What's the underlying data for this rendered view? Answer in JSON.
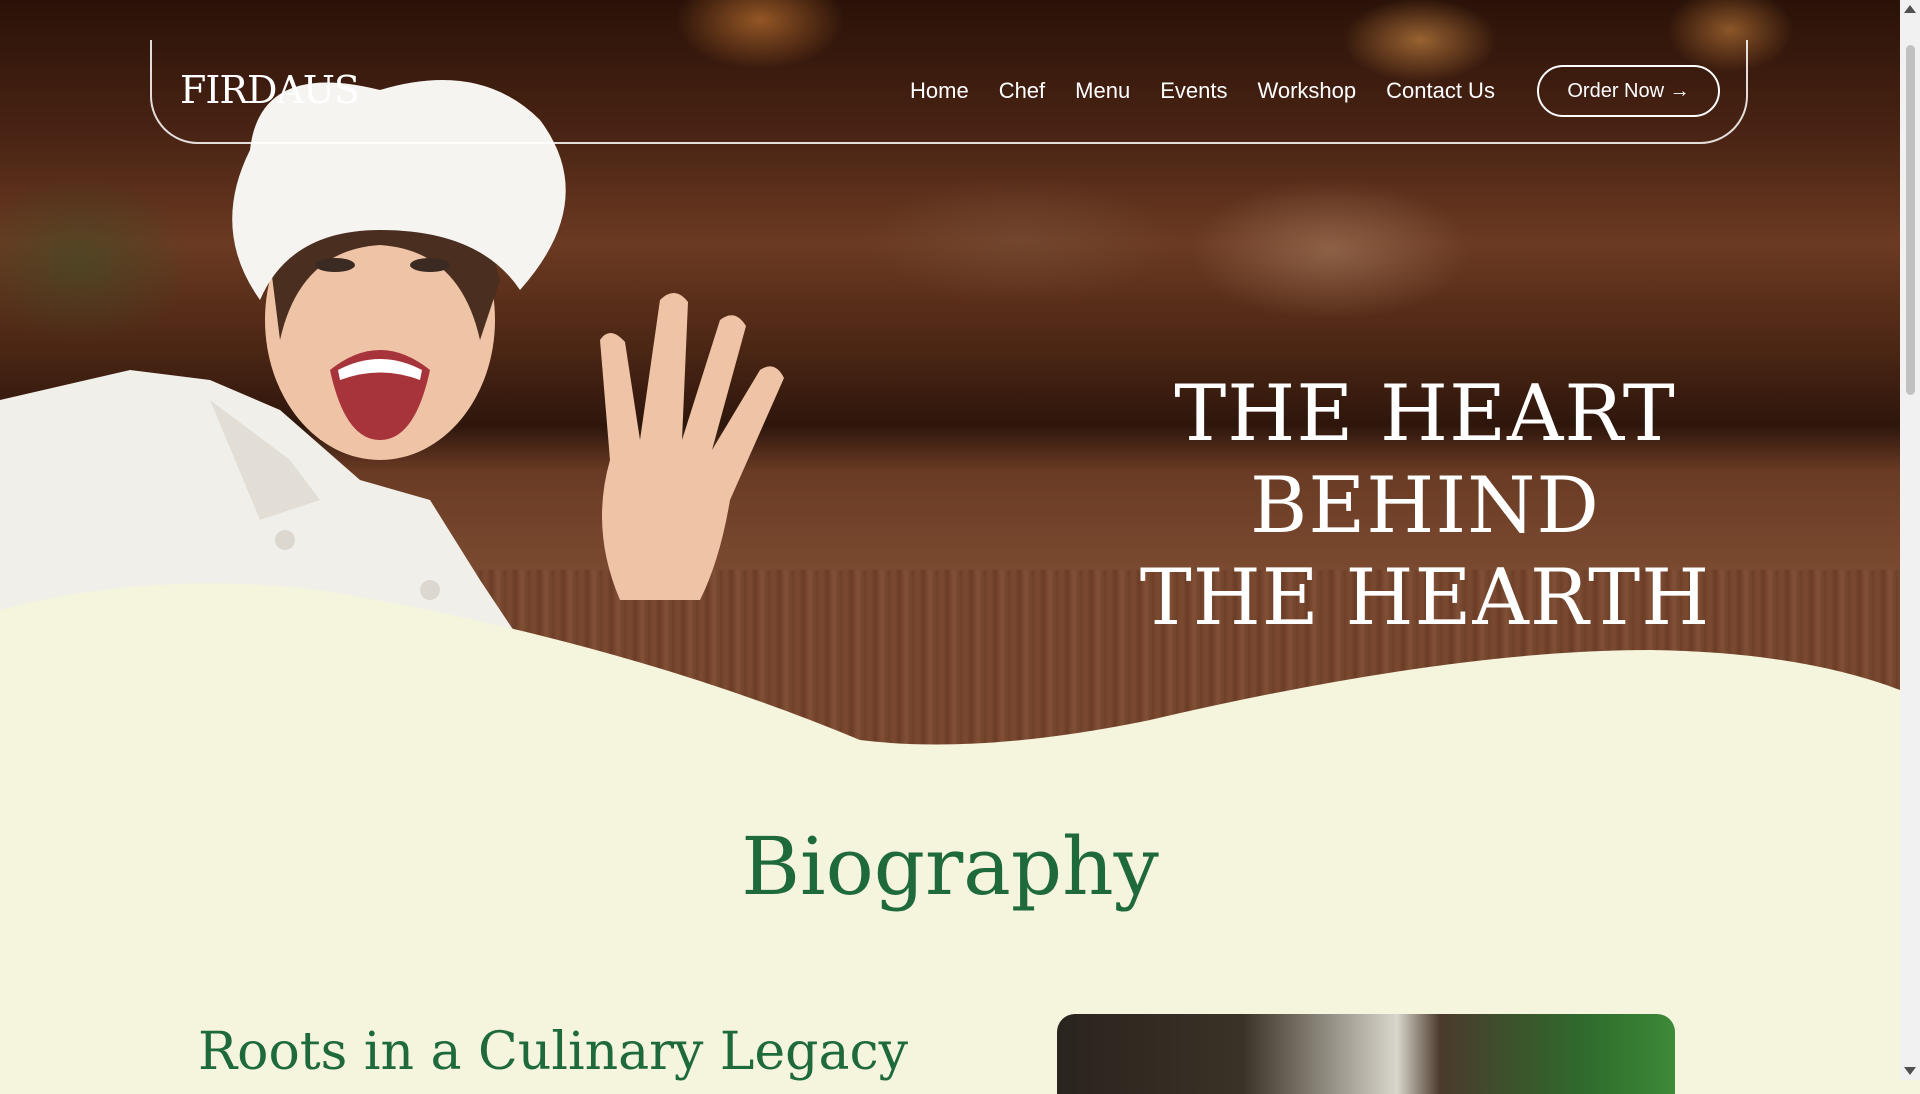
{
  "brand": {
    "logo": "FIRDAUS"
  },
  "nav": {
    "items": [
      "Home",
      "Chef",
      "Menu",
      "Events",
      "Workshop",
      "Contact Us"
    ],
    "order_label": "Order Now →"
  },
  "hero": {
    "headline_line1": "THE HEART BEHIND",
    "headline_line2": "THE HEARTH"
  },
  "biography": {
    "title": "Biography",
    "subtitle": "Roots in a Culinary Legacy"
  },
  "colors": {
    "accent_green": "#1e6a3a",
    "cream": "#f5f4dc"
  }
}
